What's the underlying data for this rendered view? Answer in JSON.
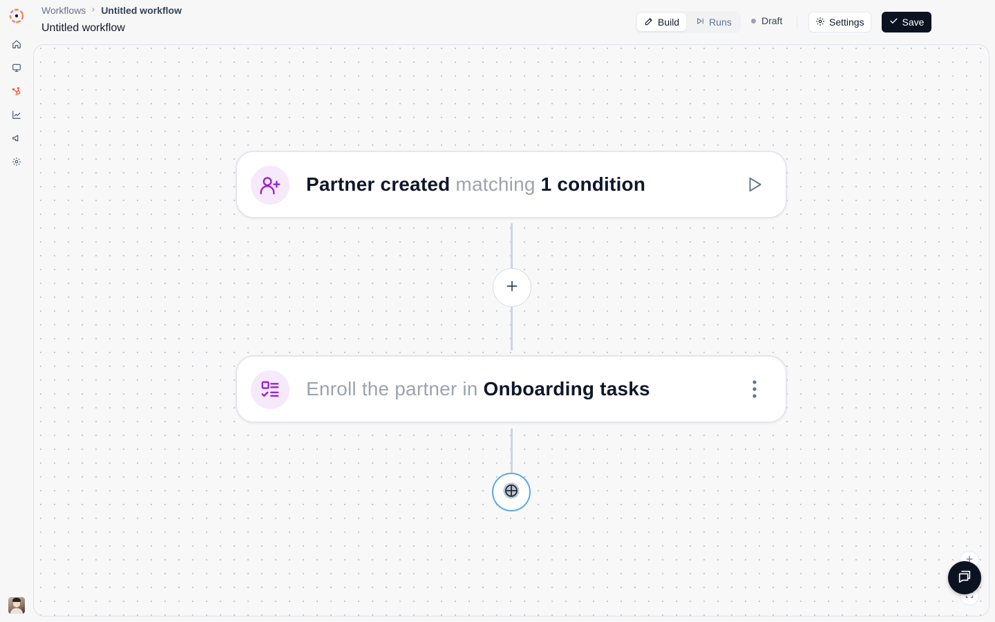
{
  "app": {
    "colors": {
      "brand_primary": "#6d28d9",
      "accent_purple": "#9b1fd6",
      "accent_blue": "#58a6ee",
      "save_bg": "#0b1220",
      "hubspot_orange": "#ff5c35"
    }
  },
  "sidebar": {
    "logo_icon": "app-logo-icon",
    "items": [
      {
        "icon": "home-icon"
      },
      {
        "icon": "monitor-icon"
      },
      {
        "icon": "hubspot-icon"
      },
      {
        "icon": "chart-line-icon"
      },
      {
        "icon": "megaphone-icon"
      },
      {
        "icon": "gear-icon"
      }
    ],
    "avatar_icon": "user-avatar"
  },
  "header": {
    "breadcrumb": {
      "root": "Workflows",
      "current": "Untitled workflow"
    },
    "title": "Untitled workflow",
    "tabs": [
      {
        "label": "Build",
        "icon": "pencil-icon",
        "active": true
      },
      {
        "label": "Runs",
        "icon": "play-skip-icon",
        "active": false
      }
    ],
    "status": "Draft",
    "settings_label": "Settings",
    "save_label": "Save"
  },
  "workflow": {
    "trigger": {
      "icon": "user-plus-icon",
      "text_strong_1": "Partner created",
      "text_muted": "matching",
      "text_strong_2": "1 condition",
      "action_icon": "play-icon"
    },
    "steps": [
      {
        "icon": "task-list-icon",
        "text_muted": "Enroll the partner in",
        "text_strong": "Onboarding tasks",
        "action_icon": "more-vertical-icon"
      }
    ],
    "add_step_icon": "plus-icon",
    "end_icon": "target-icon"
  },
  "canvas_controls": {
    "zoom_in_icon": "plus-icon",
    "fit_icon": "fit-view-icon",
    "chat_icon": "chat-icon"
  }
}
